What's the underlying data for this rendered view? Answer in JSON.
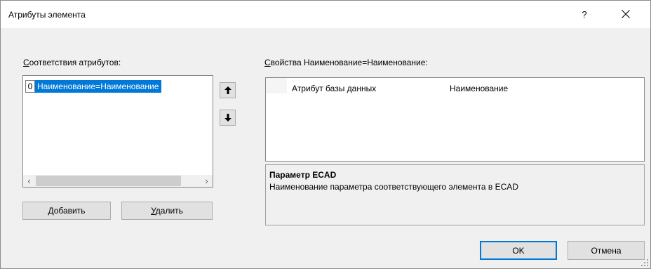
{
  "window": {
    "title": "Атрибуты элемента",
    "help": "?",
    "close": "✕"
  },
  "left_panel": {
    "label_prefix": "С",
    "label_rest": "оответствия атрибутов:",
    "items": [
      {
        "index": "0",
        "text": "Наименование=Наименование",
        "selected": true
      }
    ],
    "scroll_left": "‹",
    "scroll_right": "›",
    "add_label_accel": "Д",
    "add_label_rest": "обавить",
    "delete_label_accel": "У",
    "delete_label_rest": "далить",
    "move_up": "🡅",
    "move_down": "🡇"
  },
  "right_panel": {
    "label_prefix": "С",
    "label_rest": "войства Наименование=Наименование:",
    "grid": {
      "rows": [
        {
          "name": "Атрибут базы данных",
          "value": "Наименование"
        }
      ]
    },
    "description": {
      "title": "Параметр ECAD",
      "text": "Наименование параметра соответствующего элемента в ECAD"
    }
  },
  "footer": {
    "ok_label": "OK",
    "cancel_label": "Отмена"
  },
  "colors": {
    "selection": "#0078d7",
    "dialog_bg": "#f0f0f0",
    "default_button_border": "#0078d7"
  }
}
